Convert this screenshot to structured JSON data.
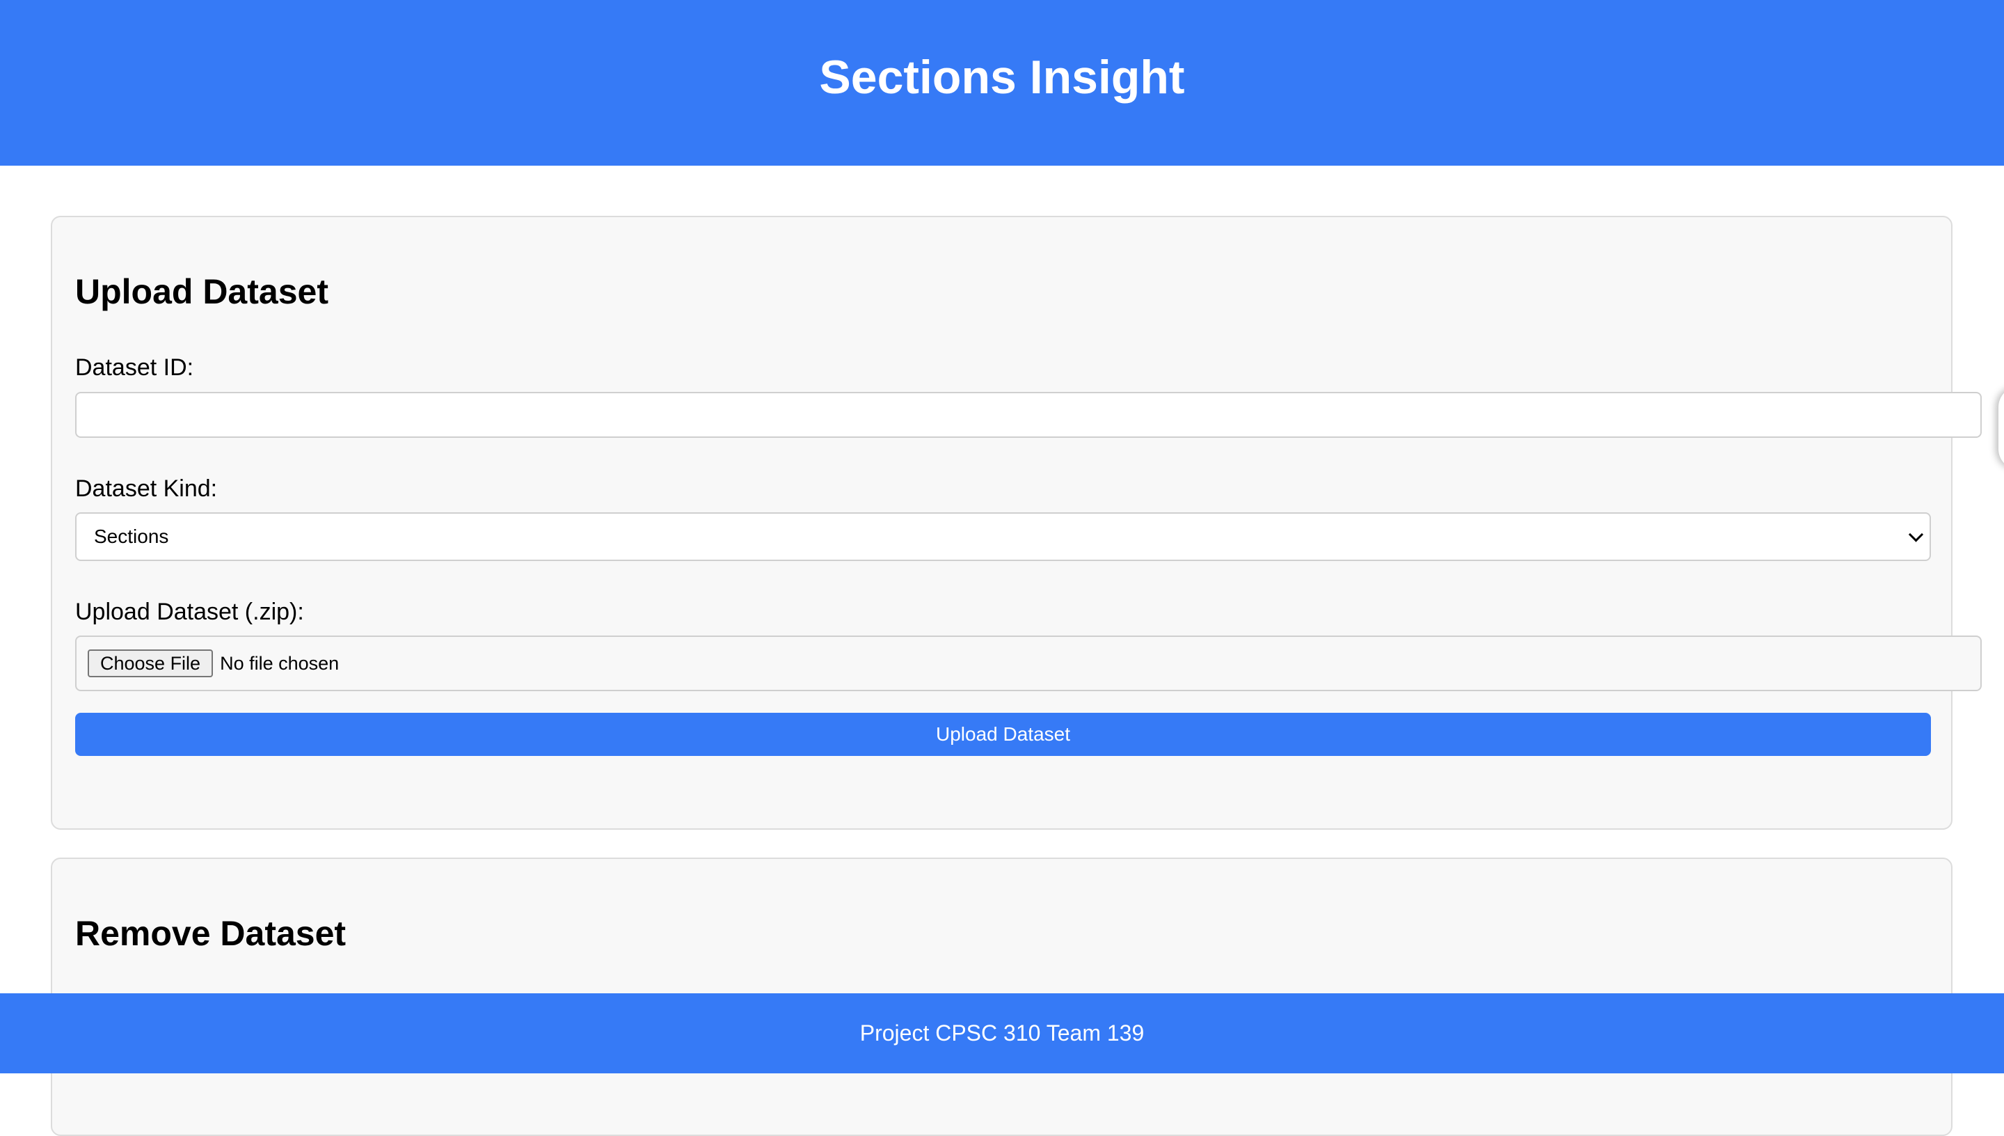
{
  "header": {
    "title": "Sections Insight"
  },
  "upload": {
    "heading": "Upload Dataset",
    "id_label": "Dataset ID:",
    "id_value": "",
    "kind_label": "Dataset Kind:",
    "kind_selected": "Sections",
    "file_label": "Upload Dataset (.zip):",
    "choose_file_label": "Choose File",
    "file_status": "No file chosen",
    "submit_label": "Upload Dataset"
  },
  "remove": {
    "heading": "Remove Dataset"
  },
  "footer": {
    "text": "Project CPSC 310 Team 139"
  },
  "colors": {
    "accent": "#367af6",
    "card_bg": "#f8f8f8"
  }
}
